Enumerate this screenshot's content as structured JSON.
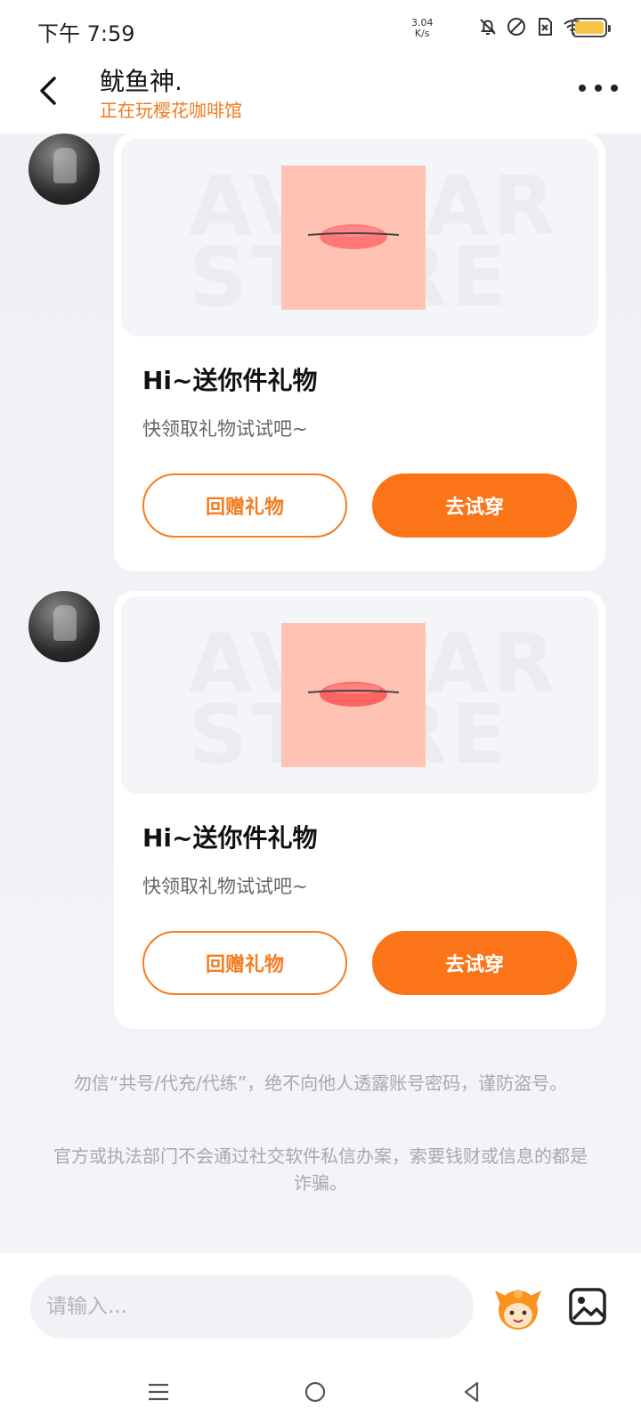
{
  "status_bar": {
    "time": "下午 7:59",
    "net_speed_value": "3.04",
    "net_speed_unit": "K/s",
    "icons": [
      "bell-off-icon",
      "dnd-icon",
      "sim-icon",
      "wifi-icon",
      "battery-icon"
    ],
    "battery_color": "#f6c343"
  },
  "header": {
    "title": "鱿鱼神.",
    "subtitle": "正在玩樱花咖啡馆",
    "accent_color": "#f07a20"
  },
  "messages": [
    {
      "card_title": "Hi~送你件礼物",
      "card_desc": "快领取礼物试试吧~",
      "return_gift_label": "回赠礼物",
      "try_on_label": "去试穿",
      "watermark": "AVATAR STORE"
    },
    {
      "card_title": "Hi~送你件礼物",
      "card_desc": "快领取礼物试试吧~",
      "return_gift_label": "回赠礼物",
      "try_on_label": "去试穿",
      "watermark": "AVATAR STORE"
    }
  ],
  "notices": [
    "勿信“共号/代充/代练”，绝不向他人透露账号密码，谨防盗号。",
    "官方或执法部门不会通过社交软件私信办案，索要钱财或信息的都是诈骗。"
  ],
  "input": {
    "placeholder": "请输入..."
  },
  "colors": {
    "primary_button": "#fb7418",
    "outline_button": "#f37d22"
  }
}
